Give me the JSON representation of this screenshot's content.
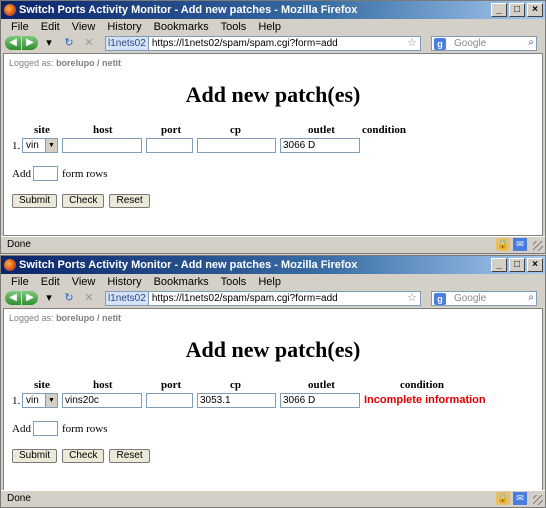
{
  "windows": [
    {
      "title": "Switch Ports Activity Monitor - Add new patches - Mozilla Firefox",
      "menu": [
        "File",
        "Edit",
        "View",
        "History",
        "Bookmarks",
        "Tools",
        "Help"
      ],
      "address": {
        "site_id": "l1nets02",
        "url": "https://l1nets02/spam/spam.cgi?form=add"
      },
      "search": {
        "placeholder": "Google"
      },
      "logged_as": {
        "prefix": "Logged as:",
        "user": "borelupo / netit"
      },
      "heading": "Add new patch(es)",
      "columns": [
        "site",
        "host",
        "port",
        "cp",
        "outlet",
        "condition"
      ],
      "row": {
        "index": "1.",
        "site": "vin",
        "host": "",
        "port": "",
        "cp": "",
        "outlet": "3066 D",
        "condition": ""
      },
      "add_rows": {
        "label_before": "Add",
        "value": "",
        "label_after": "form rows"
      },
      "buttons": {
        "submit": "Submit",
        "check": "Check",
        "reset": "Reset"
      },
      "status": "Done"
    },
    {
      "title": "Switch Ports Activity Monitor - Add new patches - Mozilla Firefox",
      "menu": [
        "File",
        "Edit",
        "View",
        "History",
        "Bookmarks",
        "Tools",
        "Help"
      ],
      "address": {
        "site_id": "l1nets02",
        "url": "https://l1nets02/spam/spam.cgi?form=add"
      },
      "search": {
        "placeholder": "Google"
      },
      "logged_as": {
        "prefix": "Logged as:",
        "user": "borelupo / netit"
      },
      "heading": "Add new patch(es)",
      "columns": [
        "site",
        "host",
        "port",
        "cp",
        "outlet",
        "condition"
      ],
      "row": {
        "index": "1.",
        "site": "vin",
        "host": "vins20c",
        "port": "",
        "cp": "3053.1",
        "outlet": "3066 D",
        "condition": "Incomplete information"
      },
      "add_rows": {
        "label_before": "Add",
        "value": "",
        "label_after": "form rows"
      },
      "buttons": {
        "submit": "Submit",
        "check": "Check",
        "reset": "Reset"
      },
      "status": "Done"
    }
  ],
  "colors": {
    "error": "#e00000",
    "titlebar": "#0a246a"
  }
}
